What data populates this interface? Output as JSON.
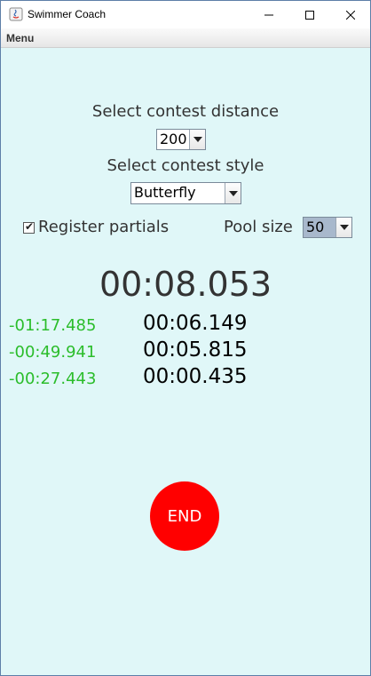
{
  "window": {
    "title": "Swimmer Coach"
  },
  "menu": {
    "label": "Menu"
  },
  "distance": {
    "label": "Select contest distance",
    "value": "200"
  },
  "style": {
    "label": "Select contest style",
    "value": "Butterfly"
  },
  "partials": {
    "label": "Register partials",
    "checked": true
  },
  "pool": {
    "label": "Pool size",
    "value": "50"
  },
  "timer": {
    "main": "00:08.053"
  },
  "splits": [
    {
      "diff": "-01:17.485",
      "time": "00:06.149"
    },
    {
      "diff": "-00:49.941",
      "time": "00:05.815"
    },
    {
      "diff": "-00:27.443",
      "time": "00:00.435"
    }
  ],
  "end_button": {
    "label": "END",
    "color": "#ff0000"
  },
  "colors": {
    "background": "#e0f7f8",
    "diff_text": "#2bbd2b"
  }
}
